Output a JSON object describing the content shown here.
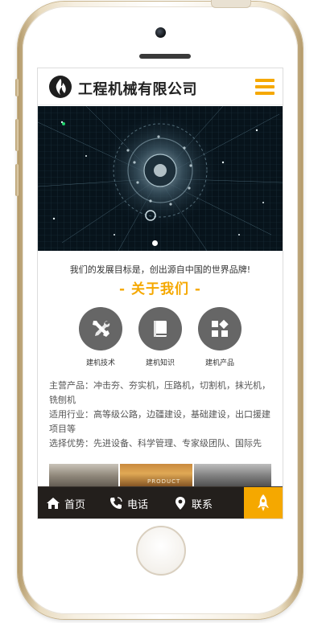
{
  "header": {
    "brand": "工程机械有限公司",
    "logo_icon": "flame-logo-icon",
    "menu_icon": "hamburger-menu-icon"
  },
  "banner": {
    "image": "circuit-globe-banner",
    "slides": 1
  },
  "about": {
    "tagline": "我们的发展目标是，创出源自中国的世界品牌!",
    "title": "- 关于我们 -"
  },
  "features": [
    {
      "label": "建机技术",
      "icon": "tools-icon"
    },
    {
      "label": "建机知识",
      "icon": "book-icon"
    },
    {
      "label": "建机产品",
      "icon": "products-grid-icon"
    }
  ],
  "description": [
    "主营产品：冲击夯、夯实机，压路机，切割机，抹光机，铣刨机",
    "适用行业：高等级公路，边疆建设，基础建设，出口援建项目等",
    "选择优势：先进设备、科学管理、专家级团队、国际先"
  ],
  "photo_caption": "PRODUCT",
  "footer": {
    "items": [
      {
        "label": "首页",
        "icon": "home-icon"
      },
      {
        "label": "电话",
        "icon": "phone-icon"
      },
      {
        "label": "联系",
        "icon": "location-pin-icon"
      }
    ],
    "top_button_icon": "rocket-icon"
  },
  "colors": {
    "accent": "#f5a800",
    "footer_bg": "#231f1c",
    "icon_circle": "#666666"
  }
}
